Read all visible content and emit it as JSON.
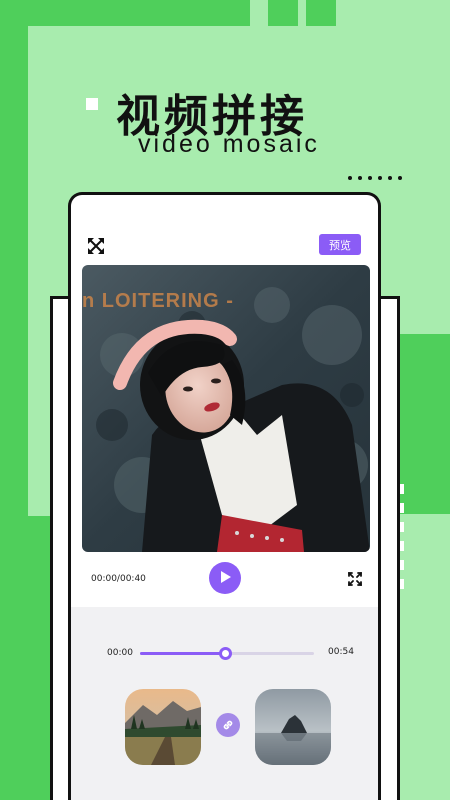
{
  "promo": {
    "title": "视频拼接",
    "subtitle": "video mosaic"
  },
  "editor": {
    "close_icon": "close-arrows-icon",
    "preview_label": "预览",
    "current_time": "00:00/00:40",
    "play_icon": "play-icon",
    "fullscreen_icon": "fullscreen-icon"
  },
  "trim": {
    "start_label": "00:00",
    "end_label": "00:54",
    "progress": 0.49
  },
  "clips": [
    {
      "icon": "landscape-thumbnail"
    },
    {
      "icon": "misty-lake-thumbnail"
    }
  ],
  "link_icon": "link-icon",
  "colors": {
    "accent": "#8b5cf6",
    "bg_green": "#4fcf5b",
    "bg_light_green": "#a8ecae"
  }
}
